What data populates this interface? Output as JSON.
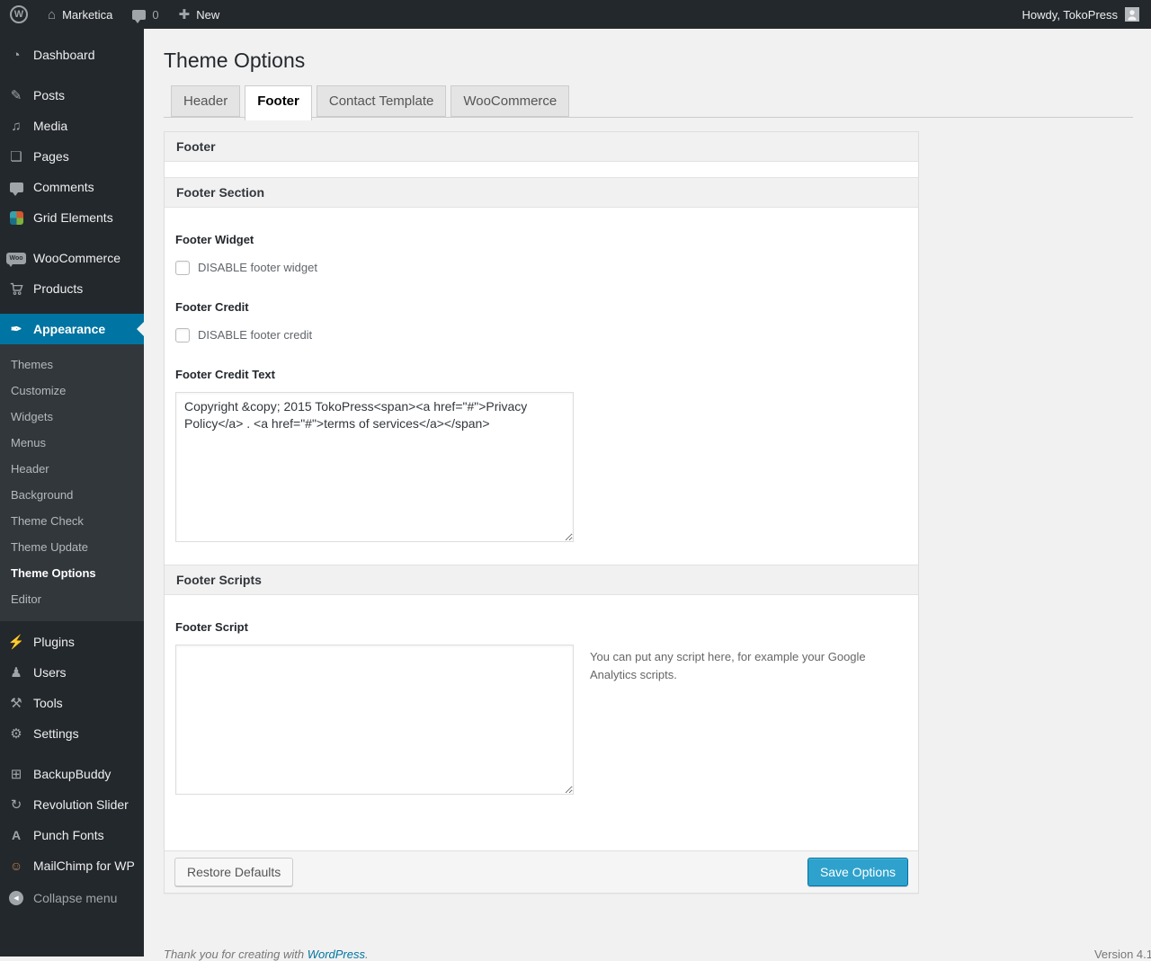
{
  "colors": {
    "accent": "#0074a2",
    "admin_bar_bg": "#23282d",
    "menu_bg": "#23282d",
    "submenu_bg": "#32373c",
    "primary_button_bg": "#2ea2cc",
    "page_bg": "#f1f1f1",
    "link": "#0074a2"
  },
  "admin_bar": {
    "site_name": "Marketica",
    "comment_count": "0",
    "new_label": "New",
    "howdy": "Howdy, TokoPress"
  },
  "icons": {
    "wp_logo": "W",
    "home": "⌂",
    "plus": "✚",
    "comments": "css-bubble-shape",
    "dashboard": "◔",
    "posts": "✎",
    "media": "♫",
    "pages": "❏",
    "grid_elements": "css-pinwheel-shape",
    "woocommerce": "Woo",
    "products": "svg-cart-shape",
    "appearance": "✒",
    "plugins": "⚡",
    "users": "♟",
    "tools": "⚒",
    "settings": "⚙",
    "backupbuddy": "⊞",
    "revolution_slider": "↻",
    "punch_fonts": "A",
    "mailchimp": "☺",
    "collapse": "◀"
  },
  "sidebar": {
    "items": [
      {
        "label": "Dashboard"
      },
      {
        "label": "Posts"
      },
      {
        "label": "Media"
      },
      {
        "label": "Pages"
      },
      {
        "label": "Comments"
      },
      {
        "label": "Grid Elements"
      },
      {
        "label": "WooCommerce"
      },
      {
        "label": "Products"
      },
      {
        "label": "Appearance"
      }
    ],
    "current_item": "Appearance",
    "appearance_submenu": [
      {
        "label": "Themes"
      },
      {
        "label": "Customize"
      },
      {
        "label": "Widgets"
      },
      {
        "label": "Menus"
      },
      {
        "label": "Header"
      },
      {
        "label": "Background"
      },
      {
        "label": "Theme Check"
      },
      {
        "label": "Theme Update"
      },
      {
        "label": "Theme Options"
      },
      {
        "label": "Editor"
      }
    ],
    "current_submenu_item": "Theme Options",
    "bottom_items": [
      {
        "label": "Plugins"
      },
      {
        "label": "Users"
      },
      {
        "label": "Tools"
      },
      {
        "label": "Settings"
      },
      {
        "label": "BackupBuddy"
      },
      {
        "label": "Revolution Slider"
      },
      {
        "label": "Punch Fonts"
      },
      {
        "label": "MailChimp for WP"
      }
    ],
    "collapse_label": "Collapse menu"
  },
  "main": {
    "page_title": "Theme Options",
    "tabs": [
      {
        "label": "Header",
        "active": false
      },
      {
        "label": "Footer",
        "active": true
      },
      {
        "label": "Contact Template",
        "active": false
      },
      {
        "label": "WooCommerce",
        "active": false
      }
    ],
    "panel_title": "Footer",
    "sections": [
      {
        "title": "Footer Section",
        "fields": [
          {
            "label": "Footer Widget",
            "checkbox_label": "DISABLE footer widget",
            "checked": false
          },
          {
            "label": "Footer Credit",
            "checkbox_label": "DISABLE footer credit",
            "checked": false
          },
          {
            "label": "Footer Credit Text",
            "textarea_value": "Copyright &copy; 2015 TokoPress<span><a href=\"#\">Privacy Policy</a> . <a href=\"#\">terms of services</a></span>"
          }
        ]
      },
      {
        "title": "Footer Scripts",
        "fields": [
          {
            "label": "Footer Script",
            "textarea_value": "",
            "help": "You can put any script here, for example your Google Analytics scripts."
          }
        ]
      }
    ],
    "buttons": {
      "restore": "Restore Defaults",
      "save": "Save Options"
    }
  },
  "page_footer": {
    "thanks_prefix": "Thank you for creating with ",
    "wordpress_link": "WordPress",
    "thanks_suffix": ".",
    "version": "Version 4.1"
  }
}
